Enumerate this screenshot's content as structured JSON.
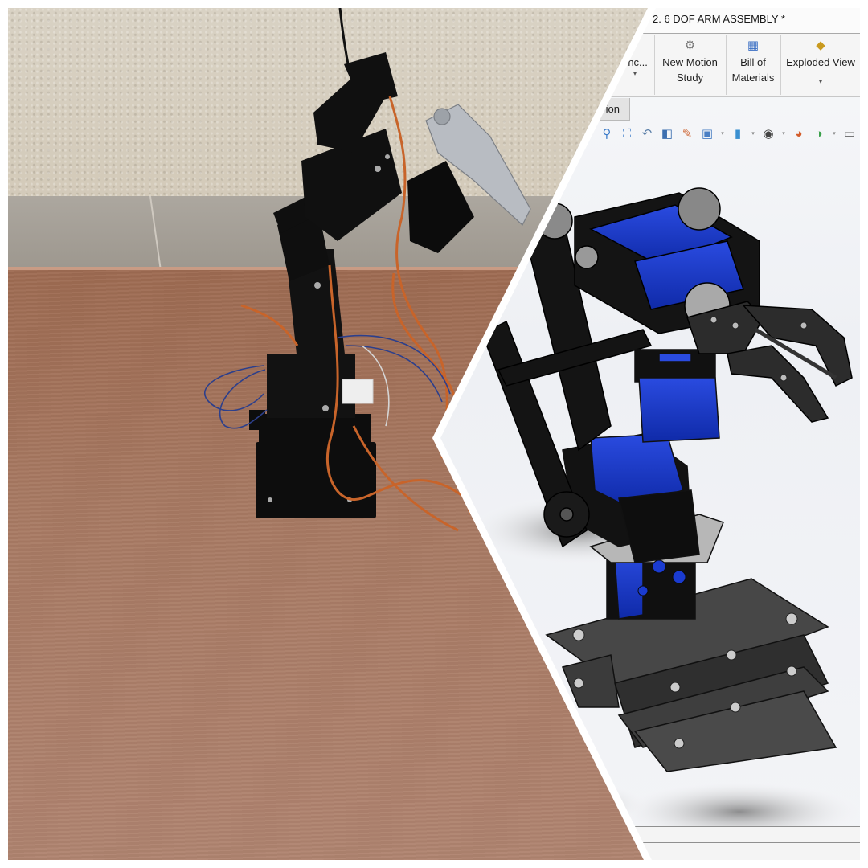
{
  "image": {
    "description": "Side-by-side comparison: photo of a physical 6-DOF robotic arm on a wooden table (left) and a SolidWorks CAD assembly of the same arm (right)",
    "left_panel": {
      "subject": "physical robot arm photo",
      "elements": [
        "textured wall",
        "grey baseboard",
        "wooden table",
        "black aluminum robot arm",
        "orange servo cables",
        "blue jumper wires",
        "mini breadboard"
      ]
    }
  },
  "cad_window": {
    "title": "2. 6 DOF ARM ASSEMBLY *",
    "ribbon": {
      "buttons": [
        {
          "label_line1": "enc...",
          "label_line2": "",
          "icon": "reference-icon",
          "has_dropdown": true
        },
        {
          "label_line1": "New Motion",
          "label_line2": "Study",
          "icon": "gears-icon",
          "has_dropdown": false
        },
        {
          "label_line1": "Bill of",
          "label_line2": "Materials",
          "icon": "bill-of-materials-icon",
          "has_dropdown": false
        },
        {
          "label_line1": "Exploded View",
          "label_line2": "",
          "icon": "exploded-view-icon",
          "has_dropdown": true
        }
      ]
    },
    "tab": {
      "label": "ion"
    },
    "heads_up_toolbar": [
      {
        "icon": "zoom-to-fit-icon",
        "glyph": "🔍"
      },
      {
        "icon": "zoom-to-area-icon",
        "glyph": "⬚"
      },
      {
        "icon": "previous-view-icon",
        "glyph": "↶"
      },
      {
        "icon": "section-view-icon",
        "glyph": "◧"
      },
      {
        "icon": "dynamic-annotation-icon",
        "glyph": "✎"
      },
      {
        "icon": "view-orientation-icon",
        "glyph": "⬛",
        "dropdown": true
      },
      {
        "icon": "display-style-icon",
        "glyph": "▣",
        "dropdown": true
      },
      {
        "icon": "hide-show-items-icon",
        "glyph": "👁",
        "dropdown": true
      },
      {
        "icon": "edit-appearance-icon",
        "glyph": "◐"
      },
      {
        "icon": "apply-scene-icon",
        "glyph": "◑",
        "dropdown": true
      },
      {
        "icon": "view-settings-icon",
        "glyph": "▭"
      }
    ],
    "colors": {
      "servo_blue": "#1432c8",
      "bracket_black": "#141414",
      "plate_grey": "#3c3c3c",
      "viewport_bg": "#f1f3f6"
    }
  }
}
